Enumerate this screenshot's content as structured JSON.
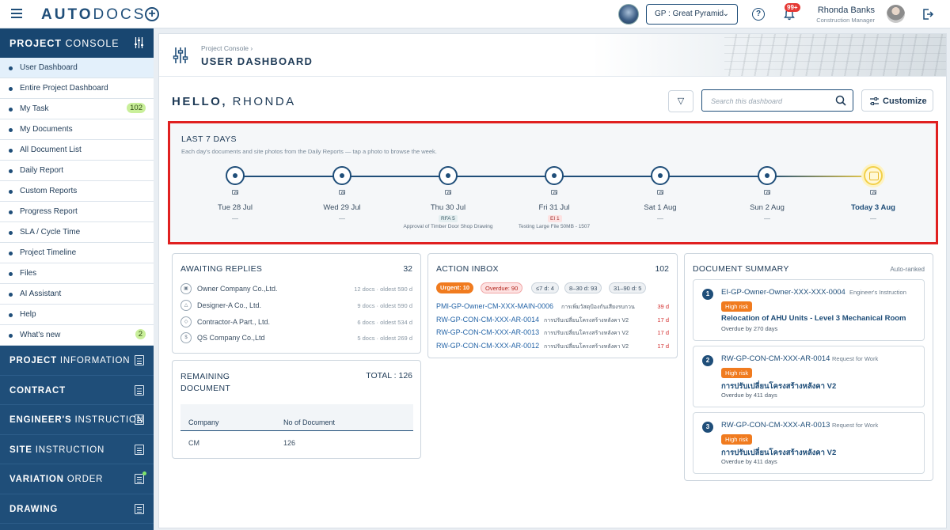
{
  "app": {
    "logo_bold": "AUTO",
    "logo_light": "DOCS"
  },
  "topbar": {
    "project_select": "GP : Great Pyramid",
    "notif_badge": "99+",
    "user_name": "Rhonda Banks",
    "user_role": "Construction Manager",
    "help_glyph": "?"
  },
  "sidebar": {
    "head_bold": "PROJECT",
    "head_light": " CONSOLE",
    "items": [
      {
        "label": "User Dashboard"
      },
      {
        "label": "Entire Project Dashboard"
      },
      {
        "label": "My Task",
        "badge": "102"
      },
      {
        "label": "My Documents"
      },
      {
        "label": "All Document List"
      },
      {
        "label": "Daily Report"
      },
      {
        "label": "Custom Reports"
      },
      {
        "label": "Progress Report"
      },
      {
        "label": "SLA / Cycle Time"
      },
      {
        "label": "Project Timeline"
      },
      {
        "label": "Files"
      },
      {
        "label": "AI Assistant"
      },
      {
        "label": "Help"
      },
      {
        "label": "What's new",
        "badge": "2"
      }
    ],
    "sections": [
      {
        "bold": "PROJECT",
        "light": " INFORMATION"
      },
      {
        "bold": "CONTRACT",
        "light": ""
      },
      {
        "bold": "ENGINEER'S",
        "light": " INSTRUCTION"
      },
      {
        "bold": "SITE",
        "light": " INSTRUCTION"
      },
      {
        "bold": "VARIATION",
        "light": " ORDER"
      },
      {
        "bold": "DRAWING",
        "light": ""
      }
    ]
  },
  "header": {
    "breadcrumb": "Project Console  ›",
    "title": "USER DASHBOARD"
  },
  "greeting": {
    "hello": "HELLO,",
    "name": "RHONDA"
  },
  "toolbar": {
    "search_placeholder": "Search this dashboard",
    "customize": "Customize"
  },
  "week": {
    "title": "LAST 7 DAYS",
    "subtitle": "Each day's documents and site photos from the Daily Reports — tap a photo to browse the week.",
    "days": [
      {
        "label": "Tue 28 Jul",
        "dash": "—"
      },
      {
        "label": "Wed 29 Jul",
        "dash": "—"
      },
      {
        "label": "Thu 30 Jul",
        "tag": "RFA 5",
        "note": "Approval of Timber Door Shop Drawing"
      },
      {
        "label": "Fri 31 Jul",
        "tag": "EI 1",
        "note": "Testing Large File 50MB - 1507"
      },
      {
        "label": "Sat 1 Aug",
        "dash": "—"
      },
      {
        "label": "Sun 2 Aug",
        "dash": "—"
      },
      {
        "label": "Today 3 Aug",
        "dash": "—"
      }
    ]
  },
  "awaiting": {
    "title": "AWAITING REPLIES",
    "count": "32",
    "rows": [
      {
        "name": "Owner Company Co.,Ltd.",
        "meta": "12 docs · oldest 590 d"
      },
      {
        "name": "Designer-A Co., Ltd.",
        "meta": "9 docs · oldest 590 d"
      },
      {
        "name": "Contractor-A Part., Ltd.",
        "meta": "6 docs · oldest 534 d"
      },
      {
        "name": "QS Company Co.,Ltd",
        "meta": "5 docs · oldest 269 d"
      }
    ]
  },
  "remaining": {
    "title_line1": "REMAINING",
    "title_line2": "DOCUMENT",
    "total": "TOTAL : 126",
    "columns": [
      "Company",
      "No of Document"
    ],
    "rows": [
      {
        "company": "CM",
        "count": "126"
      }
    ]
  },
  "inbox": {
    "title": "ACTION INBOX",
    "count": "102",
    "chips": {
      "urgent": "Urgent: 10",
      "overdue": "Overdue: 90",
      "c7": "≤7 d: 4",
      "c8_30": "8–30 d: 93",
      "c31_90": "31–90 d: 5"
    },
    "rows": [
      {
        "code": "PMI-GP-Owner-CM-XXX-MAIN-0006",
        "desc": "การเพิ่มวัสดุป้องกันเสียงรบกวน",
        "age": "39 d"
      },
      {
        "code": "RW-GP-CON-CM-XXX-AR-0014",
        "desc": "การปรับเปลี่ยนโครงสร้างหลังคา V2",
        "age": "17 d"
      },
      {
        "code": "RW-GP-CON-CM-XXX-AR-0013",
        "desc": "การปรับเปลี่ยนโครงสร้างหลังคา V2",
        "age": "17 d"
      },
      {
        "code": "RW-GP-CON-CM-XXX-AR-0012",
        "desc": "การปรับเปลี่ยนโครงสร้างหลังคา V2",
        "age": "17 d"
      }
    ]
  },
  "summary": {
    "title": "DOCUMENT SUMMARY",
    "note": "Auto-ranked",
    "items": [
      {
        "num": "1",
        "code": "EI-GP-Owner-Owner-XXX-XXX-0004",
        "type": "Engineer's Instruction",
        "risk": "High risk",
        "title": "Relocation of AHU Units - Level 3 Mechanical Room",
        "overdue": "Overdue by 270 days"
      },
      {
        "num": "2",
        "code": "RW-GP-CON-CM-XXX-AR-0014",
        "type": "Request for Work",
        "risk": "High risk",
        "title": "การปรับเปลี่ยนโครงสร้างหลังคา V2",
        "overdue": "Overdue by 411 days"
      },
      {
        "num": "3",
        "code": "RW-GP-CON-CM-XXX-AR-0013",
        "type": "Request for Work",
        "risk": "High risk",
        "title": "การปรับเปลี่ยนโครงสร้างหลังคา V2",
        "overdue": "Overdue by 411 days"
      }
    ]
  }
}
